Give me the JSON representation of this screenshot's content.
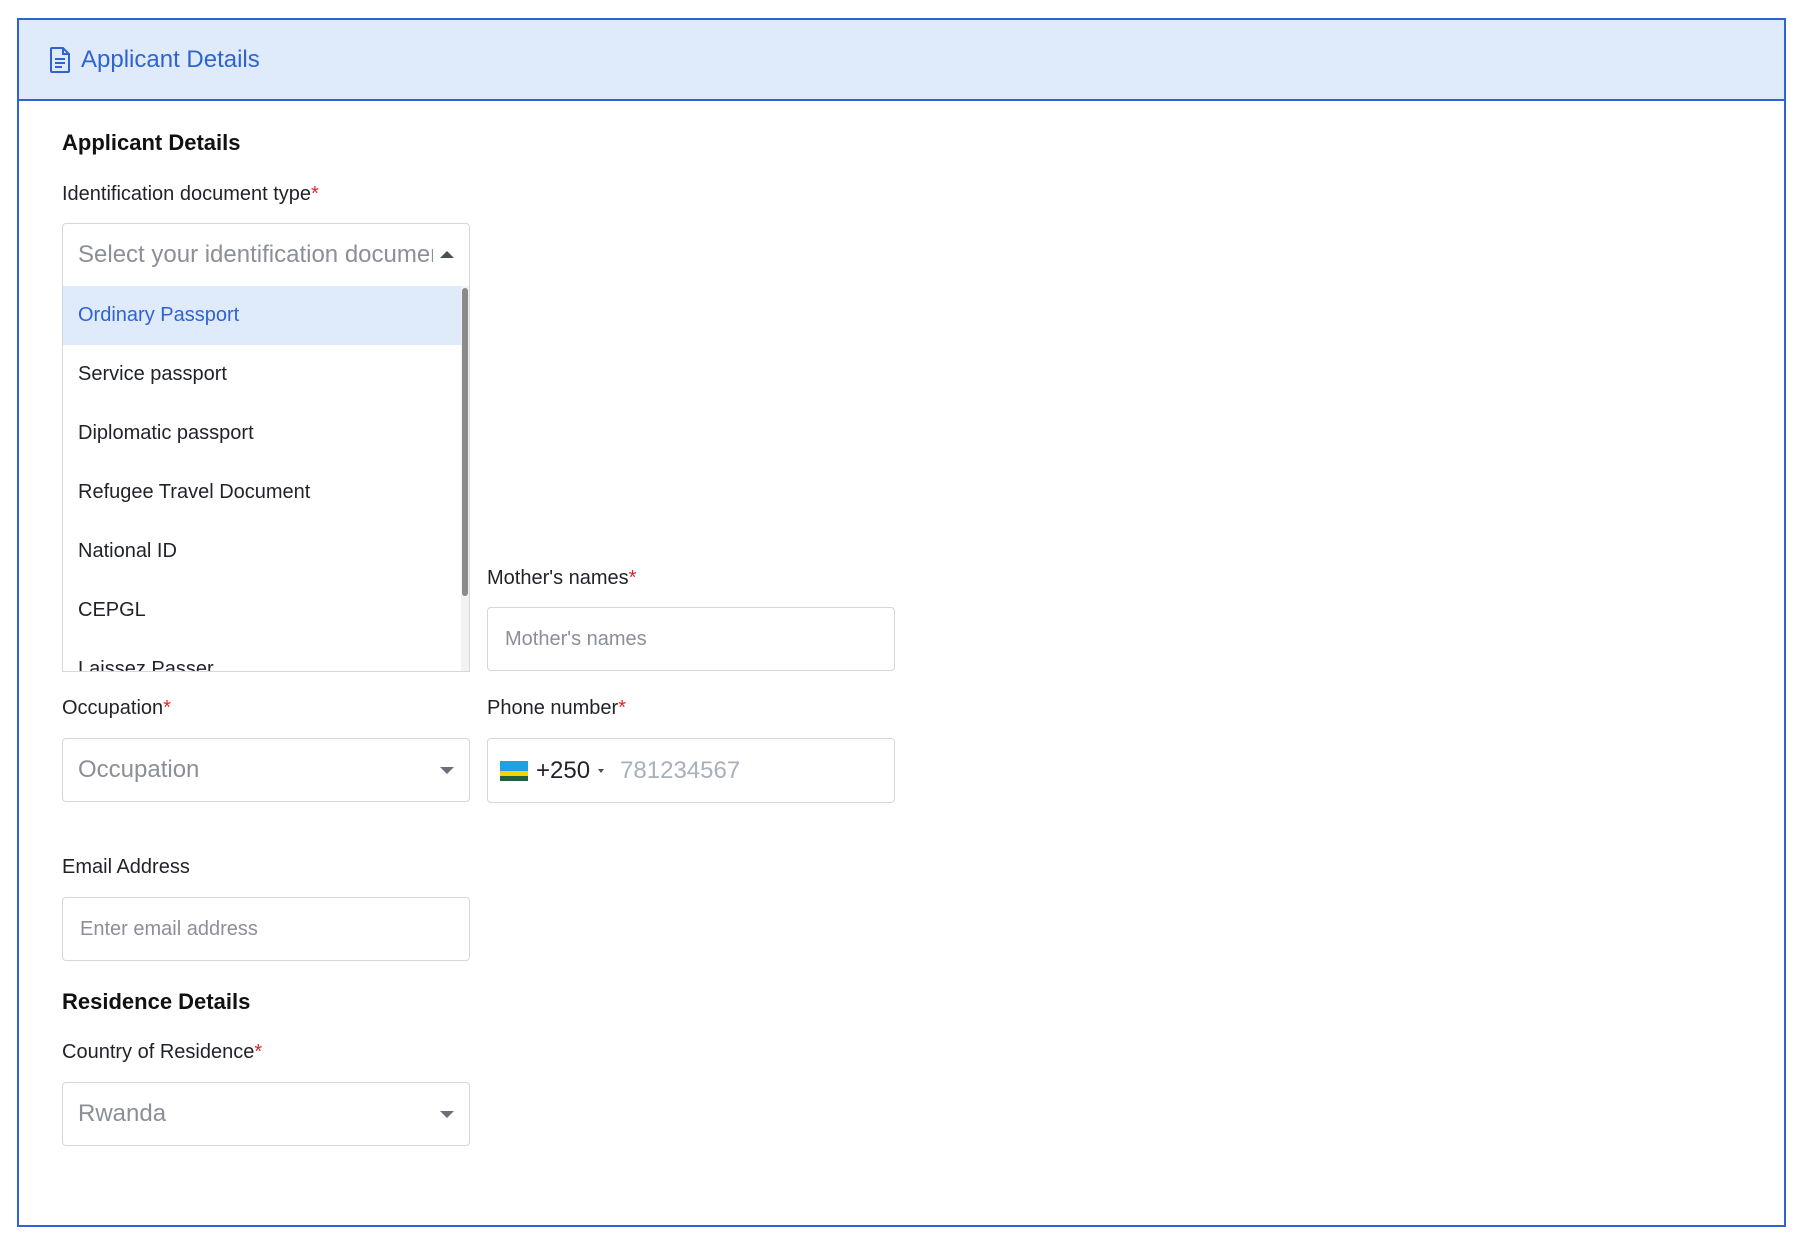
{
  "header": {
    "title": "Applicant Details",
    "icon": "document-icon"
  },
  "applicant_section": {
    "title": "Applicant Details"
  },
  "id_doc": {
    "label": "Identification document type",
    "required_mark": "*",
    "placeholder": "Select your identification documen",
    "options": [
      "Ordinary Passport",
      "Service passport",
      "Diplomatic passport",
      "Refugee Travel Document",
      "National ID",
      "CEPGL",
      "Laissez Passer"
    ],
    "highlighted_option": "Ordinary Passport"
  },
  "mothers_names": {
    "label": "Mother's names",
    "required_mark": "*",
    "placeholder": "Mother's names"
  },
  "occupation": {
    "label": "Occupation",
    "required_mark": "*",
    "placeholder": "Occupation"
  },
  "phone": {
    "label": "Phone number",
    "required_mark": "*",
    "dial_code": "+250",
    "placeholder": "781234567",
    "flag": "rwanda-flag-icon"
  },
  "email": {
    "label": "Email Address",
    "placeholder": "Enter email address"
  },
  "residence_section": {
    "title": "Residence Details"
  },
  "country_of_residence": {
    "label": "Country of Residence",
    "required_mark": "*",
    "value": "Rwanda"
  },
  "colors": {
    "accent": "#2f64d0",
    "header_bg": "#dfeafb",
    "required": "#e0242a"
  }
}
